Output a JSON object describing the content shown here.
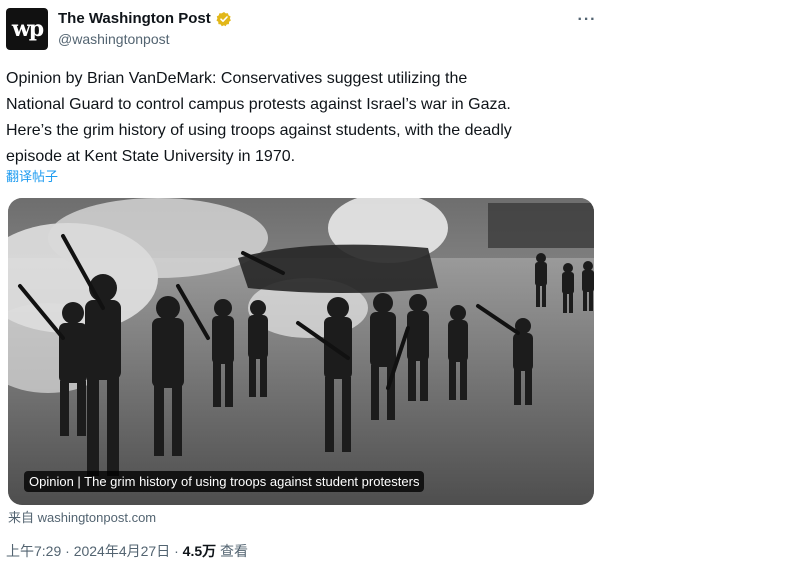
{
  "author": {
    "avatar_text": "wp",
    "name": "The Washington Post",
    "handle": "@washingtonpost",
    "verified_icon": "gold-verified-badge-icon"
  },
  "more_label": "···",
  "tweet": {
    "lines": [
      "Opinion by Brian VanDeMark: Conservatives suggest utilizing the",
      "National Guard to control campus protests against Israel’s war in Gaza.",
      "Here’s the grim history of using troops against students, with the deadly",
      "episode at Kent State University in 1970."
    ],
    "translate_label": "翻译帖子"
  },
  "card": {
    "caption": "Opinion | The grim history of using troops against student protesters",
    "source": "来自 washingtonpost.com",
    "image_icon": "black-and-white-photo-of-soldiers-marching-icon"
  },
  "meta": {
    "time": "上午7:29",
    "date": "2024年4月27日",
    "views_count": "4.5万",
    "views_label": "查看",
    "separator": "·"
  },
  "colors": {
    "link": "#1d9bf0",
    "secondary_text": "#536471",
    "verified_gold": "#e2b719"
  }
}
